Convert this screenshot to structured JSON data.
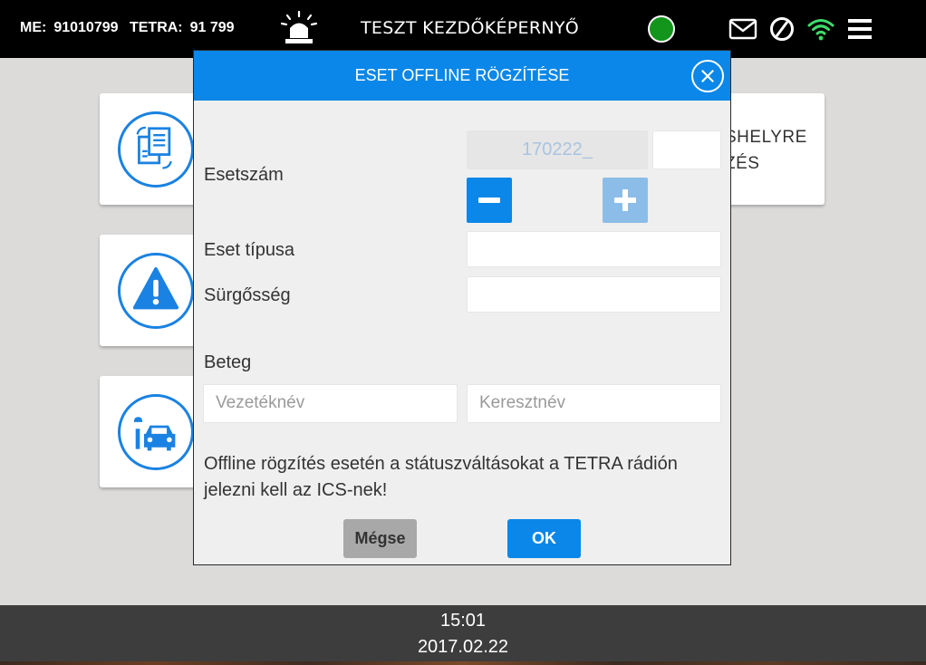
{
  "topbar": {
    "me_label": "ME:",
    "me_value": "91010799",
    "tetra_label": "TETRA:",
    "tetra_value": "91 799",
    "title": "TESZT KEZDŐKÉPERNYŐ",
    "status_color": "#13951b",
    "icons": [
      "siren-icon",
      "mail-icon",
      "block-icon",
      "wifi-icon",
      "menu-icon"
    ]
  },
  "background": {
    "card_right_text_line1": "SHELYRE",
    "card_right_text_line2": "ZÉS",
    "card_icons": [
      "documents-sync-icon",
      "warning-icon",
      "vehicle-service-icon"
    ]
  },
  "modal": {
    "title": "ESET OFFLINE RÖGZÍTÉSE",
    "case_number_label": "Esetszám",
    "case_prefix": "170222_",
    "case_suffix": "",
    "case_type_label": "Eset típusa",
    "case_type_value": "",
    "urgency_label": "Sürgősség",
    "urgency_value": "",
    "patient_label": "Beteg",
    "last_name_placeholder": "Vezetéknév",
    "first_name_placeholder": "Keresztnév",
    "notice": "Offline rögzítés esetén a státuszváltásokat a TETRA rádión jelezni kell az ICS-nek!",
    "cancel_label": "Mégse",
    "ok_label": "OK"
  },
  "bottombar": {
    "time": "15:01",
    "date": "2017.02.22"
  },
  "colors": {
    "accent": "#0a87e8",
    "accent_disabled": "#8cbde8",
    "background": "#dcdbda",
    "wifi": "#3ddc6a"
  }
}
